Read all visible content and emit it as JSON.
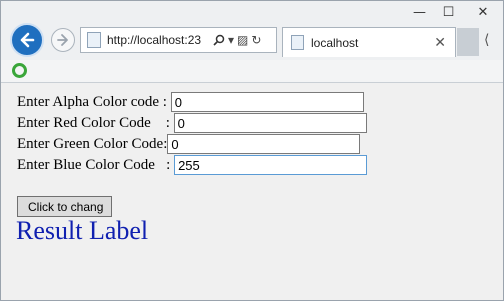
{
  "browser": {
    "address_url": "http://localhost:23",
    "tab_title": "localhost"
  },
  "form": {
    "alpha": {
      "label": "Enter Alpha Color code : ",
      "value": "0"
    },
    "red": {
      "label": "Enter Red Color Code    : ",
      "value": "0"
    },
    "green": {
      "label": "Enter Green Color Code:",
      "value": "0"
    },
    "blue": {
      "label": "Enter Blue Color Code   : ",
      "value": "255"
    },
    "button_label": "Click to chang",
    "result_label": "Result Label"
  },
  "colors": {
    "result_text": "#1020b0",
    "nav_back": "#1f6fbf"
  },
  "icons": [
    "back-arrow-icon",
    "forward-arrow-icon",
    "page-icon",
    "search-icon",
    "refresh-icon",
    "close-icon"
  ]
}
